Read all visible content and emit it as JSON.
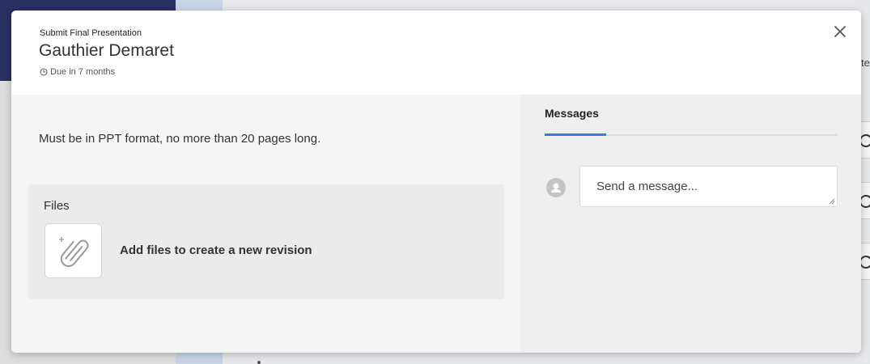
{
  "background": {
    "peek_text": "te"
  },
  "modal": {
    "task_title": "Submit Final Presentation",
    "assignee": "Gauthier Demaret",
    "due": "Due in 7 months",
    "description": "Must be in PPT format, no more than 20 pages long.",
    "files": {
      "title": "Files",
      "add_label": "Add files to create a new revision"
    },
    "messages": {
      "tab_label": "Messages",
      "input_placeholder": "Send a message..."
    }
  },
  "icons": {
    "close": "close-icon",
    "due": "clock-icon",
    "attach": "paperclip-plus-icon",
    "avatar": "user-avatar-icon"
  },
  "colors": {
    "accent": "#3a7bd5",
    "navbar": "#2a2f62"
  }
}
